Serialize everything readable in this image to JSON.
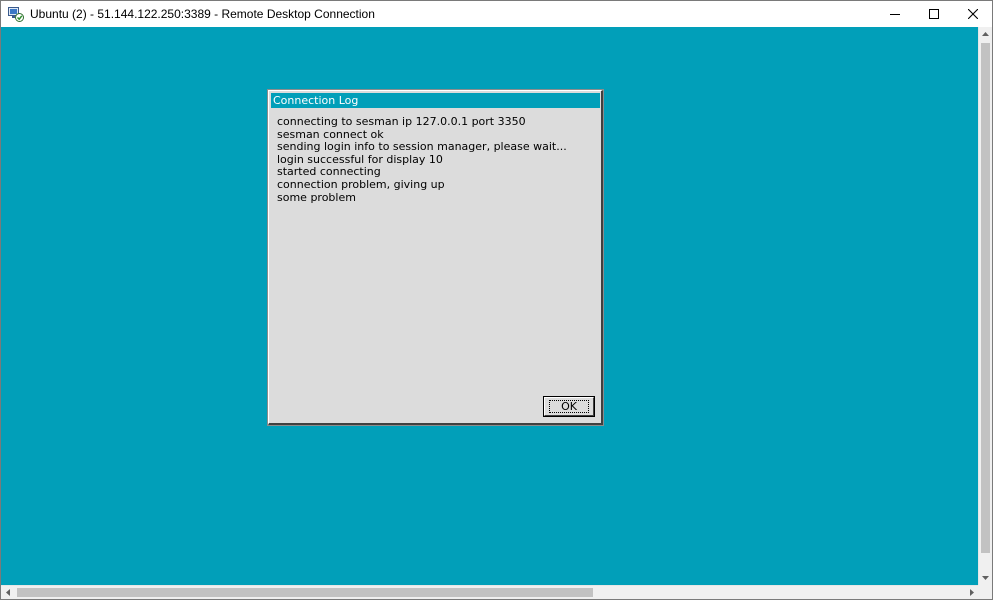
{
  "window": {
    "title": "Ubuntu (2) - 51.144.122.250:3389 - Remote Desktop Connection",
    "icon": "remote-desktop-icon",
    "controls": [
      "minimize-icon",
      "maximize-icon",
      "close-icon"
    ]
  },
  "colors": {
    "desktop_background": "#019fb9",
    "dialog_background": "#dcdcdc",
    "dialog_title_background": "#019fb9"
  },
  "dialog": {
    "title": "Connection Log",
    "log_lines": [
      "connecting to sesman ip 127.0.0.1 port 3350",
      "sesman connect ok",
      "sending login info to session manager, please wait...",
      "login successful for display 10",
      "started connecting",
      "connection problem, giving up",
      "some problem"
    ],
    "ok_label": "OK"
  }
}
